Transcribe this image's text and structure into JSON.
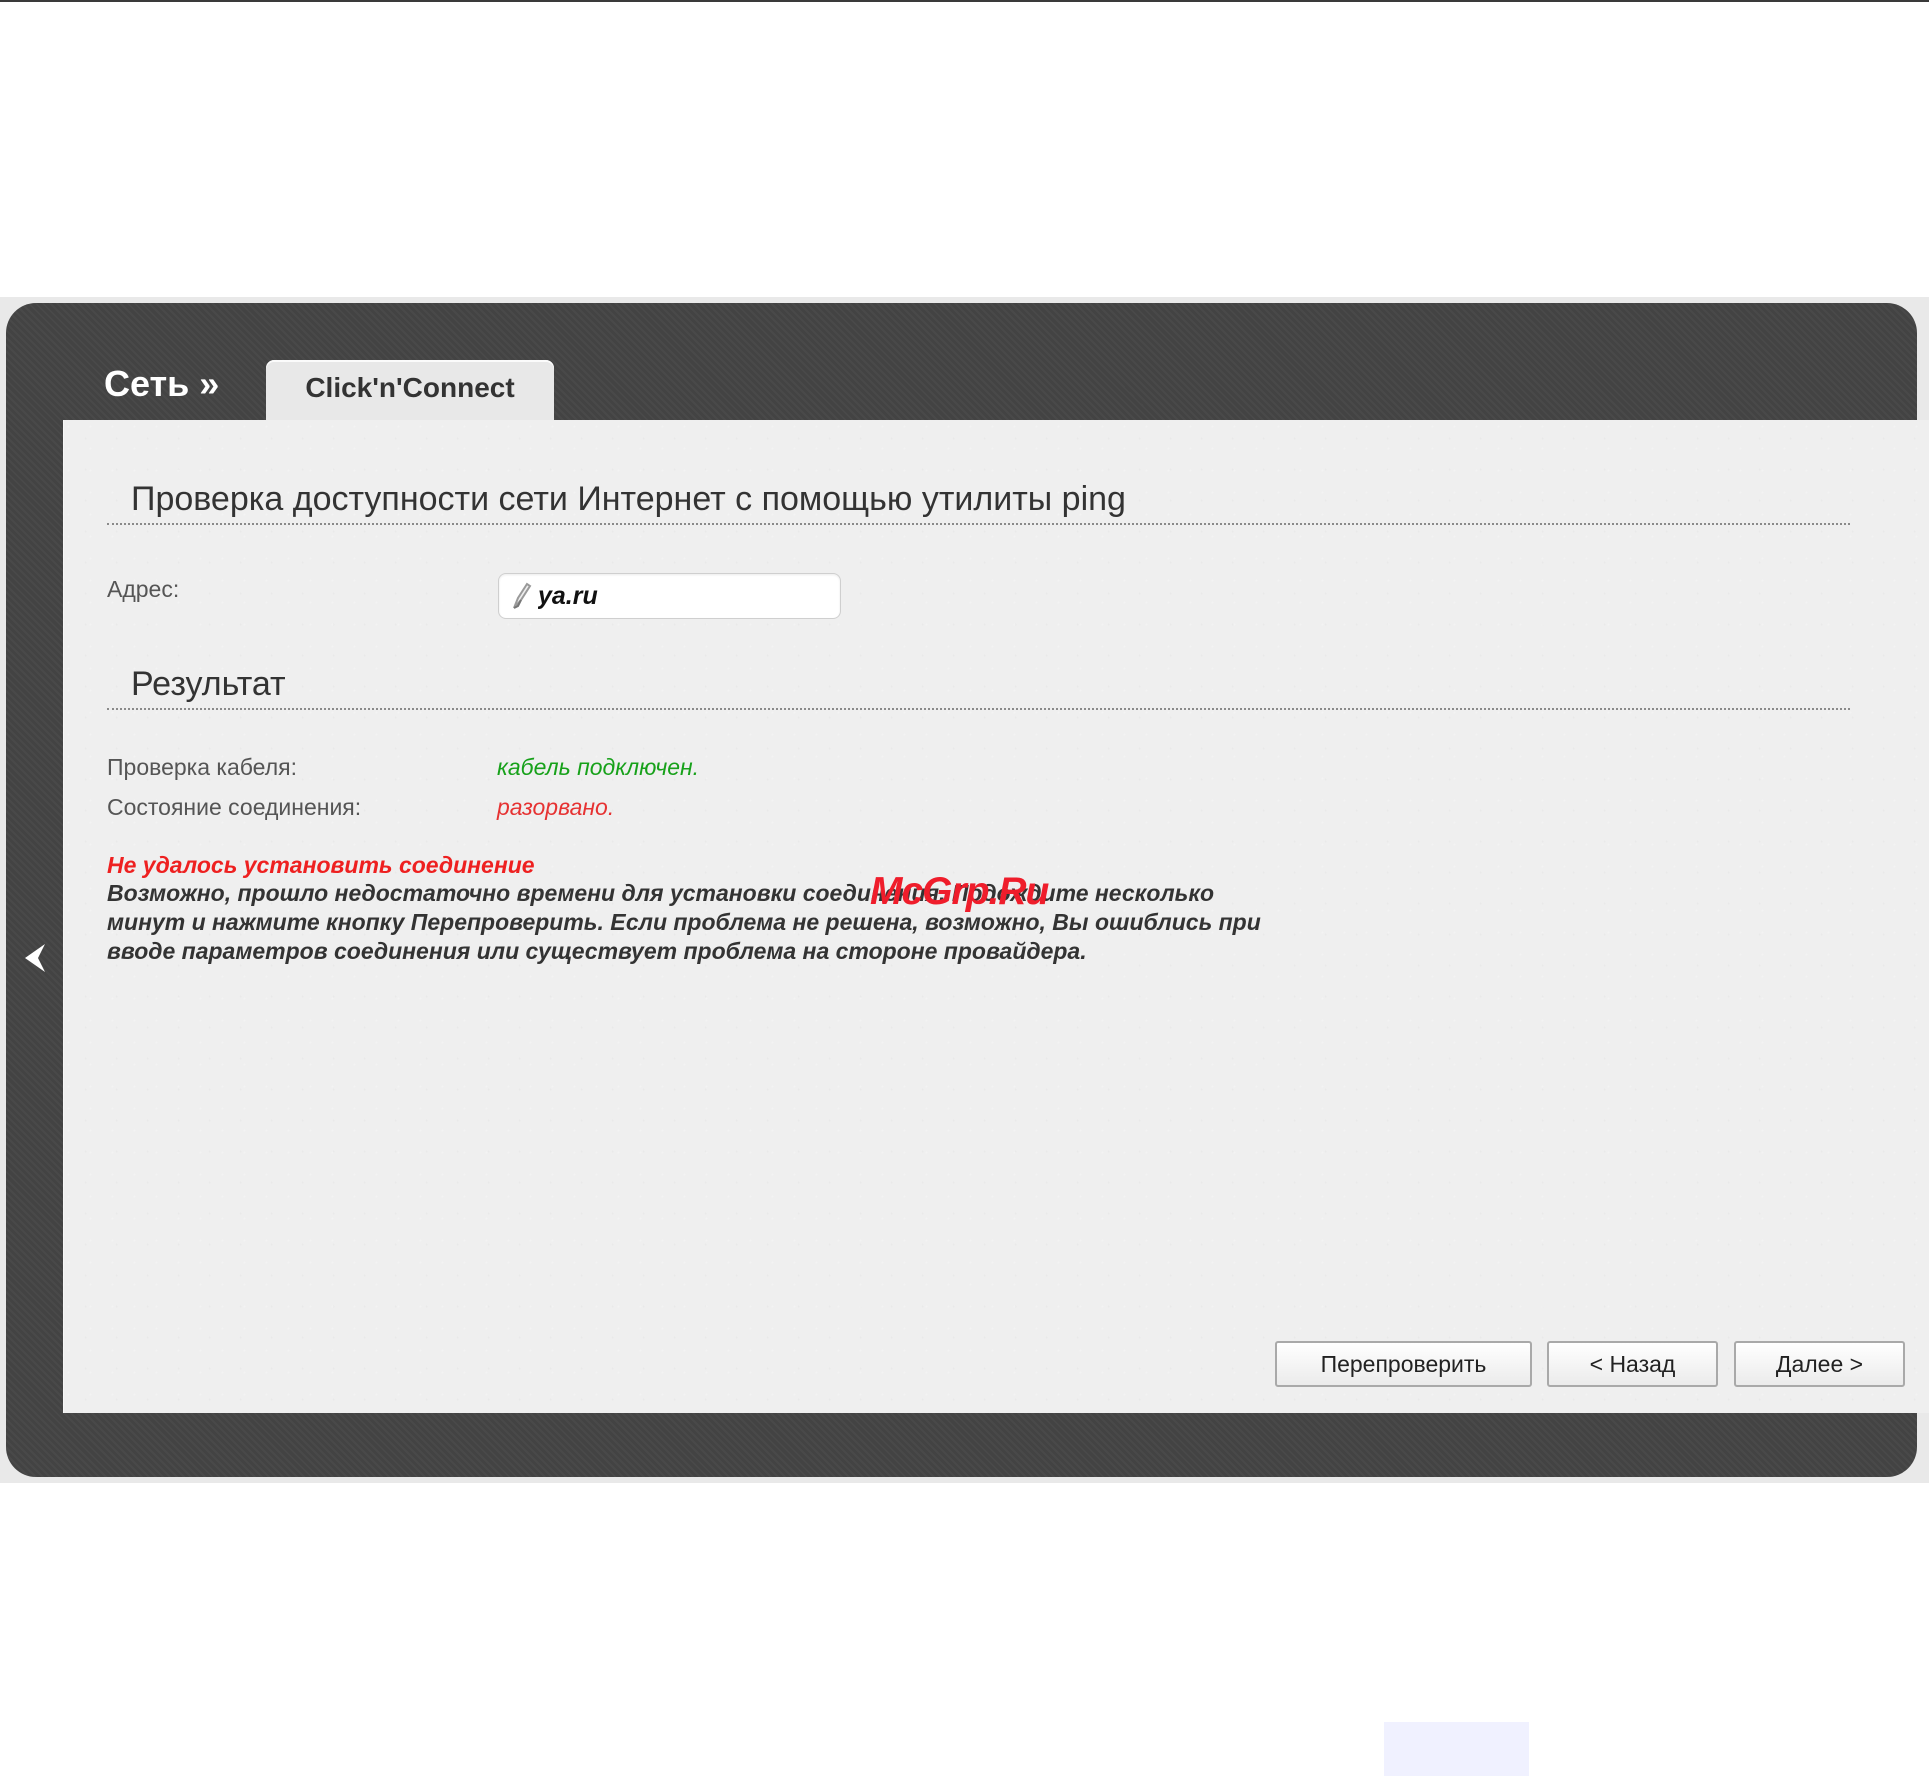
{
  "header": {
    "breadcrumb": "Сеть »",
    "tab": "Click'n'Connect"
  },
  "ping_section": {
    "title": "Проверка доступности сети Интернет с помощью утилиты ping",
    "address_label": "Адрес:",
    "address_value": "ya.ru"
  },
  "result_section": {
    "title": "Результат",
    "cable_label": "Проверка кабеля:",
    "cable_status": "кабель подключен.",
    "connection_label": "Состояние соединения:",
    "connection_status": "разорвано.",
    "error_title": "Не удалось установить соединение",
    "error_message": "Возможно, прошло недостаточно времени для установки соединения. Подождите несколько минут и нажмите кнопку Перепроверить. Если проблема не решена, возможно, Вы ошиблись при вводе параметров соединения или существует проблема на стороне провайдера."
  },
  "buttons": {
    "recheck": "Перепроверить",
    "back": "< Назад",
    "next": "Далее >"
  },
  "watermark": "McGrp.Ru",
  "icons": {
    "navigation": "chevron-left-icon",
    "input": "pencil-icon"
  },
  "colors": {
    "shell": "#454545",
    "panel": "#efefef",
    "success": "#17a11a",
    "error": "#e63232"
  }
}
